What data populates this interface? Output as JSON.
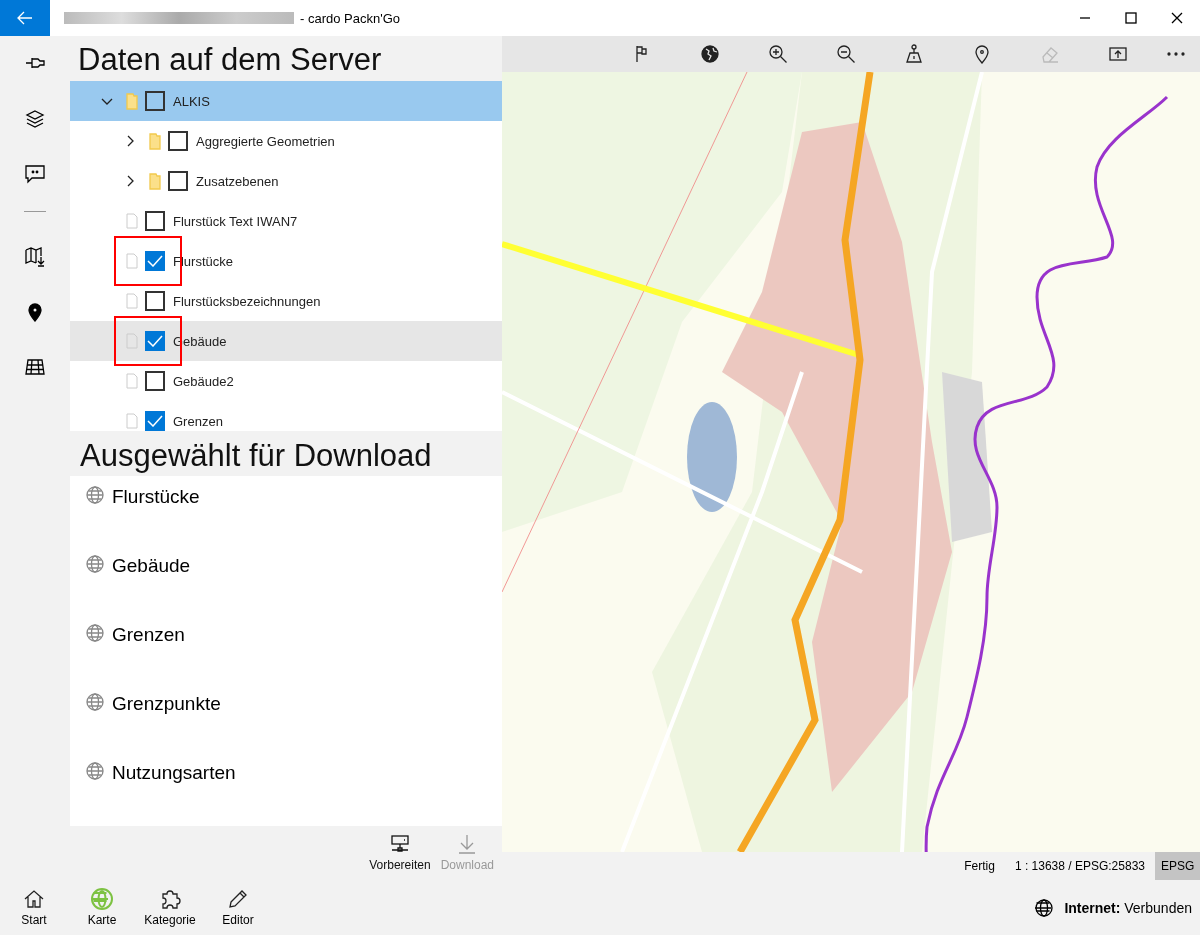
{
  "window": {
    "title": "- cardo Packn'Go"
  },
  "server_panel": {
    "title": "Daten auf dem Server",
    "tree": [
      {
        "kind": "folder",
        "label": "ALKIS",
        "expanded": true,
        "checked": false,
        "selected": true,
        "hovered": false,
        "marked": false,
        "children": [
          {
            "kind": "folder",
            "label": "Aggregierte Geometrien",
            "expanded": false,
            "checked": false,
            "selected": false,
            "hovered": false,
            "marked": false
          },
          {
            "kind": "folder",
            "label": "Zusatzebenen",
            "expanded": false,
            "checked": false,
            "selected": false,
            "hovered": false,
            "marked": false
          },
          {
            "kind": "layer",
            "label": "Flurstück Text IWAN7",
            "checked": false,
            "selected": false,
            "hovered": false,
            "marked": false
          },
          {
            "kind": "layer",
            "label": "Flurstücke",
            "checked": true,
            "selected": false,
            "hovered": false,
            "marked": true
          },
          {
            "kind": "layer",
            "label": "Flurstücksbezeichnungen",
            "checked": false,
            "selected": false,
            "hovered": false,
            "marked": false
          },
          {
            "kind": "layer",
            "label": "Gebäude",
            "checked": true,
            "selected": false,
            "hovered": true,
            "marked": true
          },
          {
            "kind": "layer",
            "label": "Gebäude2",
            "checked": false,
            "selected": false,
            "hovered": false,
            "marked": false
          },
          {
            "kind": "layer",
            "label": "Grenzen",
            "checked": true,
            "selected": false,
            "hovered": false,
            "marked": false
          }
        ]
      }
    ]
  },
  "download_panel": {
    "title": "Ausgewählt für Download",
    "items": [
      "Flurstücke",
      "Gebäude",
      "Grenzen",
      "Grenzpunkte",
      "Nutzungsarten"
    ],
    "actions": [
      {
        "label": "Vorbereiten",
        "disabled": false
      },
      {
        "label": "Download",
        "disabled": true
      }
    ]
  },
  "map_toolbar": [
    {
      "disabled": false
    },
    {
      "disabled": false
    },
    {
      "disabled": false
    },
    {
      "disabled": false
    },
    {
      "disabled": false
    },
    {
      "disabled": false
    },
    {
      "disabled": true
    },
    {
      "disabled": false
    },
    {
      "disabled": false
    }
  ],
  "status_bar": {
    "state": "Fertig",
    "scale": "1 : 13638 / EPSG:25833",
    "epsg_button": "EPSG"
  },
  "bottom_nav": [
    {
      "label": "Start",
      "selected": false
    },
    {
      "label": "Karte",
      "selected": true
    },
    {
      "label": "Kategorie",
      "selected": false
    },
    {
      "label": "Editor",
      "selected": false
    }
  ],
  "connection": {
    "label": "Internet:",
    "value": "Verbunden"
  }
}
